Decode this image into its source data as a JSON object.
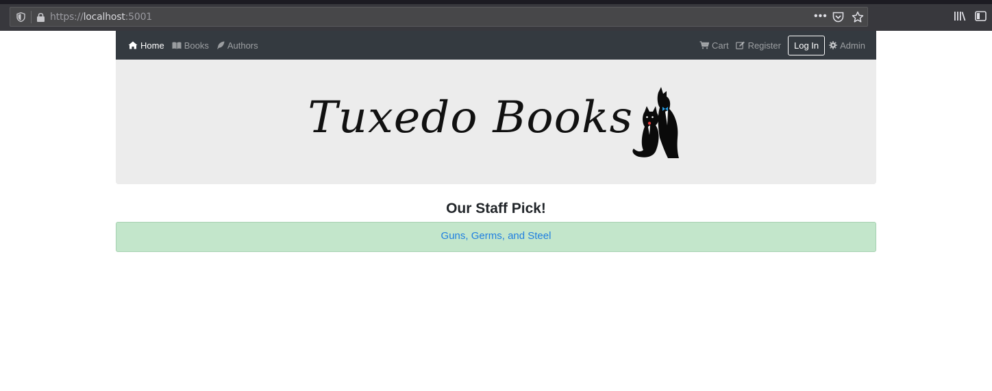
{
  "browser": {
    "url_scheme": "https://",
    "url_host": "localhost",
    "url_port": ":5001",
    "more_label": "•••"
  },
  "navbar": {
    "left": [
      {
        "label": "Home",
        "icon": "home-icon"
      },
      {
        "label": "Books",
        "icon": "book-icon"
      },
      {
        "label": "Authors",
        "icon": "feather-icon"
      }
    ],
    "right": [
      {
        "label": "Cart",
        "icon": "cart-icon"
      },
      {
        "label": "Register",
        "icon": "edit-icon"
      },
      {
        "label": "Log In"
      },
      {
        "label": "Admin",
        "icon": "gear-icon"
      }
    ]
  },
  "jumbotron": {
    "logo_text": "Tuxedo Books",
    "logo_icon": "tuxedo-cats-logo"
  },
  "main": {
    "staff_pick_title": "Our Staff Pick!",
    "staff_pick_book": "Guns, Germs, and Steel"
  },
  "colors": {
    "navbar_bg": "#343a40",
    "jumbotron_bg": "#ececec",
    "alert_bg": "#c3e6cb",
    "link": "#1f7fe0"
  }
}
